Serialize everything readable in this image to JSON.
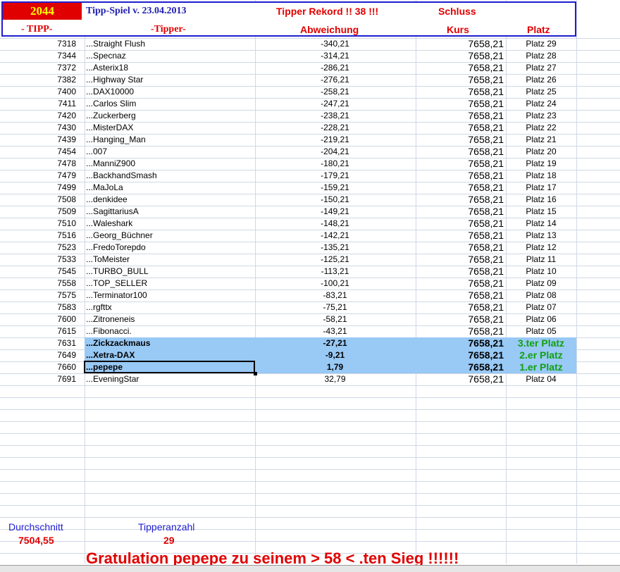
{
  "header": {
    "year": "2044",
    "title": "Tipp-Spiel v. 23.04.2013",
    "record": "Tipper Rekord !!  38  !!!",
    "schluss": "Schluss",
    "col_tipp": "- TIPP-",
    "col_tipper": "-Tipper-",
    "col_abweichung": "Abweichung",
    "col_kurs": "Kurs",
    "col_platz": "Platz"
  },
  "rows": [
    {
      "tipp": "7318",
      "name": "...Straight Flush",
      "abw": "-340,21",
      "kurs": "7658,21",
      "platz": "Platz 29"
    },
    {
      "tipp": "7344",
      "name": "...Specnaz",
      "abw": "-314,21",
      "kurs": "7658,21",
      "platz": "Platz 28"
    },
    {
      "tipp": "7372",
      "name": "...Asterix18",
      "abw": "-286,21",
      "kurs": "7658,21",
      "platz": "Platz 27"
    },
    {
      "tipp": "7382",
      "name": "...Highway Star",
      "abw": "-276,21",
      "kurs": "7658,21",
      "platz": "Platz 26"
    },
    {
      "tipp": "7400",
      "name": "...DAX10000",
      "abw": "-258,21",
      "kurs": "7658,21",
      "platz": "Platz 25"
    },
    {
      "tipp": "7411",
      "name": "...Carlos Slim",
      "abw": "-247,21",
      "kurs": "7658,21",
      "platz": "Platz 24"
    },
    {
      "tipp": "7420",
      "name": "...Zuckerberg",
      "abw": "-238,21",
      "kurs": "7658,21",
      "platz": "Platz 23"
    },
    {
      "tipp": "7430",
      "name": "...MisterDAX",
      "abw": "-228,21",
      "kurs": "7658,21",
      "platz": "Platz 22"
    },
    {
      "tipp": "7439",
      "name": "...Hanging_Man",
      "abw": "-219,21",
      "kurs": "7658,21",
      "platz": "Platz 21"
    },
    {
      "tipp": "7454",
      "name": "...007",
      "abw": "-204,21",
      "kurs": "7658,21",
      "platz": "Platz 20"
    },
    {
      "tipp": "7478",
      "name": "...ManniZ900",
      "abw": "-180,21",
      "kurs": "7658,21",
      "platz": "Platz 19"
    },
    {
      "tipp": "7479",
      "name": "...BackhandSmash",
      "abw": "-179,21",
      "kurs": "7658,21",
      "platz": "Platz 18"
    },
    {
      "tipp": "7499",
      "name": "...MaJoLa",
      "abw": "-159,21",
      "kurs": "7658,21",
      "platz": "Platz 17"
    },
    {
      "tipp": "7508",
      "name": "...denkidee",
      "abw": "-150,21",
      "kurs": "7658,21",
      "platz": "Platz 16"
    },
    {
      "tipp": "7509",
      "name": "...SagittariusA",
      "abw": "-149,21",
      "kurs": "7658,21",
      "platz": "Platz 15"
    },
    {
      "tipp": "7510",
      "name": "...Waleshark",
      "abw": "-148,21",
      "kurs": "7658,21",
      "platz": "Platz 14"
    },
    {
      "tipp": "7516",
      "name": "...Georg_Büchner",
      "abw": "-142,21",
      "kurs": "7658,21",
      "platz": "Platz 13"
    },
    {
      "tipp": "7523",
      "name": "...FredoTorepdo",
      "abw": "-135,21",
      "kurs": "7658,21",
      "platz": "Platz 12"
    },
    {
      "tipp": "7533",
      "name": "...ToMeister",
      "abw": "-125,21",
      "kurs": "7658,21",
      "platz": "Platz 11"
    },
    {
      "tipp": "7545",
      "name": "...TURBO_BULL",
      "abw": "-113,21",
      "kurs": "7658,21",
      "platz": "Platz 10"
    },
    {
      "tipp": "7558",
      "name": "...TOP_SELLER",
      "abw": "-100,21",
      "kurs": "7658,21",
      "platz": "Platz 09"
    },
    {
      "tipp": "7575",
      "name": "...Terminator100",
      "abw": "-83,21",
      "kurs": "7658,21",
      "platz": "Platz 08"
    },
    {
      "tipp": "7583",
      "name": "...rgfttx",
      "abw": "-75,21",
      "kurs": "7658,21",
      "platz": "Platz 07"
    },
    {
      "tipp": "7600",
      "name": "...Zitroneneis",
      "abw": "-58,21",
      "kurs": "7658,21",
      "platz": "Platz 06"
    },
    {
      "tipp": "7615",
      "name": "...Fibonacci.",
      "abw": "-43,21",
      "kurs": "7658,21",
      "platz": "Platz 05"
    },
    {
      "tipp": "7631",
      "name": "...Zickzackmaus",
      "abw": "-27,21",
      "kurs": "7658,21",
      "platz": "3.ter Platz",
      "highlight": true
    },
    {
      "tipp": "7649",
      "name": "...Xetra-DAX",
      "abw": "-9,21",
      "kurs": "7658,21",
      "platz": "2.er Platz",
      "highlight": true
    },
    {
      "tipp": "7660",
      "name": "...pepepe",
      "abw": "1,79",
      "kurs": "7658,21",
      "platz": "1.er Platz",
      "highlight": true
    },
    {
      "tipp": "7691",
      "name": "...EveningStar",
      "abw": "32,79",
      "kurs": "7658,21",
      "platz": "Platz 04"
    }
  ],
  "footer": {
    "durchschnitt_label": "Durchschnitt",
    "durchschnitt_value": "7504,55",
    "tipperanzahl_label": "Tipperanzahl",
    "tipperanzahl_value": "29",
    "congrats": "Gratulation pepepe  zu seinem > 58 < .ten Sieg !!!!!!"
  }
}
